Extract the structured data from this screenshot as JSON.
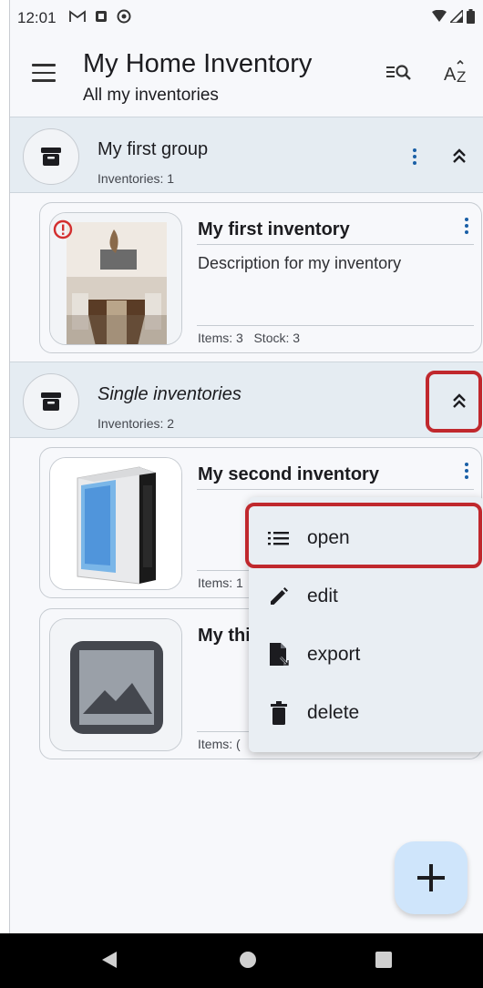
{
  "status_bar": {
    "time": "12:01"
  },
  "app_bar": {
    "title": "My Home Inventory",
    "subtitle": "All my inventories",
    "filter_action": "≡Q",
    "sort_action": "AZ"
  },
  "groups": [
    {
      "title": "My first group",
      "count": "Inventories: 1"
    },
    {
      "title": "Single inventories",
      "count": "Inventories: 2"
    }
  ],
  "inventories": [
    {
      "title": "My first inventory",
      "description": "Description for my inventory",
      "stats": "Items: 3   Stock: 3"
    },
    {
      "title": "My second inventory",
      "description": "",
      "stats": "Items: 1"
    },
    {
      "title": "My thi",
      "description": "",
      "stats": "Items: ("
    }
  ],
  "context_menu": {
    "items": [
      {
        "label": "open",
        "icon": "list-icon"
      },
      {
        "label": "edit",
        "icon": "pencil-icon"
      },
      {
        "label": "export",
        "icon": "file-export-icon"
      },
      {
        "label": "delete",
        "icon": "trash-icon"
      }
    ]
  },
  "colors": {
    "accent": "#1a5fa6",
    "highlight": "#c0282d",
    "fab": "#cfe5fb",
    "group_bg": "#e5ecf2",
    "error": "#d32f2f"
  }
}
